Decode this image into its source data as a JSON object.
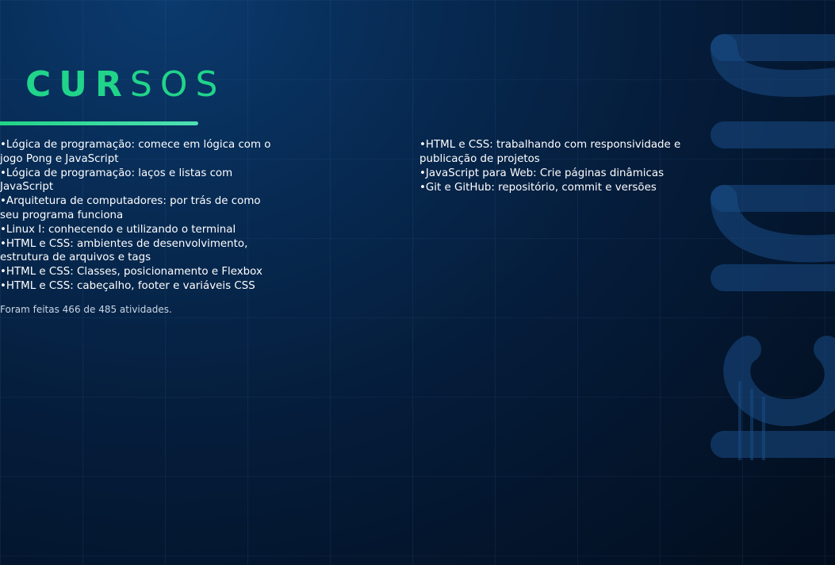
{
  "header": {
    "title_bold": "CUR",
    "title_light": "SOS"
  },
  "courses_left": [
    "Lógica de programação: comece em lógica com o jogo Pong e JavaScript",
    "Lógica de programação: laços e listas com JavaScript",
    "Arquitetura de computadores: por trás de como seu programa funciona",
    "Linux I: conhecendo e utilizando o terminal",
    "HTML e CSS: ambientes de desenvolvimento, estrutura de arquivos e tags",
    "HTML e CSS: Classes, posicionamento e Flexbox",
    "HTML e CSS: cabeçalho, footer e variáveis CSS"
  ],
  "courses_right": [
    "HTML e CSS: trabalhando com responsividade e publicação de projetos",
    "JavaScript para Web: Crie páginas dinâmicas",
    "Git e GitHub: repositório, commit e versões"
  ],
  "footnote": "Foram feitas 466 de 485 atividades.",
  "brand": {
    "watermark": "alura",
    "accent_color": "#20d48a"
  }
}
